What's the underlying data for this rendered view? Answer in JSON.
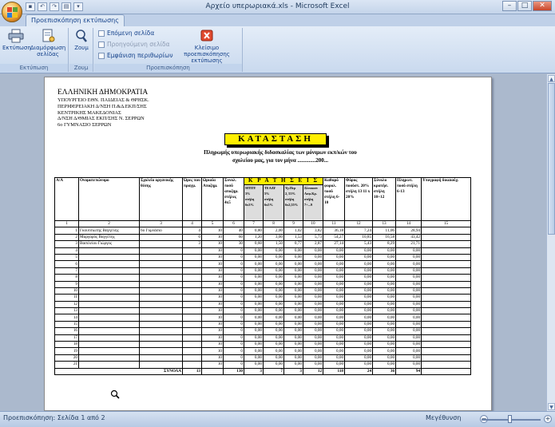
{
  "window": {
    "title": "Αρχείο υπερωριακά.xls - Microsoft Excel",
    "min": "–",
    "max": "□",
    "close": "✕"
  },
  "ribbon": {
    "tab": "Προεπισκόπηση εκτύπωσης",
    "groups": [
      {
        "label": "Εκτύπωση",
        "buttons": [
          "Εκτύπωση",
          "Διαμόρφωση σελίδας"
        ]
      },
      {
        "label": "Ζουμ",
        "buttons": [
          "Ζουμ"
        ]
      },
      {
        "label": "Προεπισκόπηση",
        "buttons": [
          "Επόμενη σελίδα",
          "Προηγούμενη σελίδα",
          "Εμφάνιση περιθωρίων",
          "Κλείσιμο προεπισκόπησης εκτύπωσης"
        ]
      }
    ]
  },
  "header": {
    "lines": [
      "ΕΛΛΗΝΙΚΗ ΔΗΜΟΚΡΑΤΙΑ",
      "ΥΠΟΥΡΓΕΙΟ ΕΘΝ. ΠΑΙΔΕΙΑΣ & ΘΡΗΣΚ.",
      "ΠΕΡΙΦΕΡΕΙΑΚΗ Δ/ΝΣΗ Π.&Δ.ΕΚΠ/ΣΗΣ",
      "ΚΕΝΤΡΙΚΗΣ ΜΑΚΕΔΟΝΙΑΣ",
      "Δ/ΝΣΗ Δ/ΘΜΙΑΣ ΕΚΠ/ΣΗΣ Ν. ΣΕΡΡΩΝ",
      "6ο ΓΥΜΝΑΣΙΟ ΣΕΡΡΩΝ"
    ]
  },
  "katastasi": "ΚΑΤΑΣΤΑΣΗ",
  "subtitle1": "Πληρωμής υπερωριακής διδασκαλίας των μόνιμων εκπ/κών του",
  "subtitle2": "σχολείου μας, για τον μήνα .............200...",
  "table": {
    "h_aa": "Α/Α",
    "h_name": "Ονοματεπώνυμο",
    "h_school": "Σχολείο οργανικής θέσης",
    "h_hours": "Ώρες που πραγμ.",
    "h_rate": "Ωριαία Αποζημ.",
    "h_total": "Συνολ. ποσό αποζημ. στήλες 4x5",
    "kratiseis": "Κ Ρ Α Τ Η Σ Ε Ι Σ",
    "sub": [
      {
        "a": "ΜΤΠΥ",
        "b": "3%",
        "c": "στήλη 6x3%"
      },
      {
        "a": "ΤΕΑΔΥ",
        "b": "5%",
        "c": "στήλη 6x5%"
      },
      {
        "a": "Υγ.Περ",
        "b": "2, 55%",
        "c": "στήλη 6x2,55%"
      },
      {
        "a": "Ξένοιαστ Ασφ.Κρ.",
        "b": "στήλη",
        "c": "7+...9"
      }
    ],
    "h_net": "Καθαρό φορολ. ποσό στήλη 6-10",
    "h_tax": "Φόρος ποσόστ. 20% στήλη 13 11 x 20%",
    "h_sumded": "Σύνολο κρατήσ. στήλη 10+12",
    "h_pay": "Πληρωτ. ποσό στήλη 6-13",
    "h_sign": "Υπογραφή δικαιούχ.",
    "colnums": [
      "1",
      "2",
      "3",
      "4",
      "5",
      "6",
      "7",
      "8",
      "9",
      "10",
      "11",
      "12",
      "13",
      "14",
      "15"
    ],
    "rows": [
      {
        "n": "1",
        "name": "Γκουτσιώτης Βαγγέλης",
        "school": "6ο Γυμνάσιο",
        "h": "4",
        "rate": "10",
        "tot": "40",
        "c7": "0,80",
        "c8": "2,00",
        "c9": "1,02",
        "c10": "3,82",
        "c11": "36,18",
        "c12": "7,24",
        "c13": "11,06",
        "c14": "28,94"
      },
      {
        "n": "2",
        "name": "Μαργαρός Βαγγέλης",
        "school": "",
        "h": "6",
        "rate": "10",
        "tot": "60",
        "c7": "1,20",
        "c8": "3,00",
        "c9": "1,53",
        "c10": "5,73",
        "c11": "54,27",
        "c12": "10,85",
        "c13": "16,58",
        "c14": "43,42"
      },
      {
        "n": "3",
        "name": "Βασιλείου Γιώργος",
        "school": "",
        "h": "3",
        "rate": "10",
        "tot": "30",
        "c7": "0,60",
        "c8": "1,50",
        "c9": "0,77",
        "c10": "2,87",
        "c11": "27,14",
        "c12": "5,43",
        "c13": "8,29",
        "c14": "21,71"
      },
      {
        "n": "4",
        "name": "",
        "school": "",
        "h": "",
        "rate": "10",
        "tot": "0",
        "c7": "0,00",
        "c8": "0,00",
        "c9": "0,00",
        "c10": "0,00",
        "c11": "0,00",
        "c12": "0,00",
        "c13": "0,00",
        "c14": "0,00"
      },
      {
        "n": "5",
        "name": "",
        "school": "",
        "h": "",
        "rate": "10",
        "tot": "0",
        "c7": "0,00",
        "c8": "0,00",
        "c9": "0,00",
        "c10": "0,00",
        "c11": "0,00",
        "c12": "0,00",
        "c13": "0,00",
        "c14": "0,00"
      },
      {
        "n": "6",
        "name": "",
        "school": "",
        "h": "",
        "rate": "10",
        "tot": "0",
        "c7": "0,00",
        "c8": "0,00",
        "c9": "0,00",
        "c10": "0,00",
        "c11": "0,00",
        "c12": "0,00",
        "c13": "0,00",
        "c14": "0,00"
      },
      {
        "n": "7",
        "name": "",
        "school": "",
        "h": "",
        "rate": "10",
        "tot": "0",
        "c7": "0,00",
        "c8": "0,00",
        "c9": "0,00",
        "c10": "0,00",
        "c11": "0,00",
        "c12": "0,00",
        "c13": "0,00",
        "c14": "0,00"
      },
      {
        "n": "8",
        "name": "",
        "school": "",
        "h": "",
        "rate": "10",
        "tot": "0",
        "c7": "0,00",
        "c8": "0,00",
        "c9": "0,00",
        "c10": "0,00",
        "c11": "0,00",
        "c12": "0,00",
        "c13": "0,00",
        "c14": "0,00"
      },
      {
        "n": "9",
        "name": "",
        "school": "",
        "h": "",
        "rate": "10",
        "tot": "0",
        "c7": "0,00",
        "c8": "0,00",
        "c9": "0,00",
        "c10": "0,00",
        "c11": "0,00",
        "c12": "0,00",
        "c13": "0,00",
        "c14": "0,00"
      },
      {
        "n": "10",
        "name": "",
        "school": "",
        "h": "",
        "rate": "10",
        "tot": "0",
        "c7": "0,00",
        "c8": "0,00",
        "c9": "0,00",
        "c10": "0,00",
        "c11": "0,00",
        "c12": "0,00",
        "c13": "0,00",
        "c14": "0,00"
      },
      {
        "n": "11",
        "name": "",
        "school": "",
        "h": "",
        "rate": "10",
        "tot": "0",
        "c7": "0,00",
        "c8": "0,00",
        "c9": "0,00",
        "c10": "0,00",
        "c11": "0,00",
        "c12": "0,00",
        "c13": "0,00",
        "c14": "0,00"
      },
      {
        "n": "12",
        "name": "",
        "school": "",
        "h": "",
        "rate": "10",
        "tot": "0",
        "c7": "0,00",
        "c8": "0,00",
        "c9": "0,00",
        "c10": "0,00",
        "c11": "0,00",
        "c12": "0,00",
        "c13": "0,00",
        "c14": "0,00"
      },
      {
        "n": "13",
        "name": "",
        "school": "",
        "h": "",
        "rate": "10",
        "tot": "0",
        "c7": "0,00",
        "c8": "0,00",
        "c9": "0,00",
        "c10": "0,00",
        "c11": "0,00",
        "c12": "0,00",
        "c13": "0,00",
        "c14": "0,00"
      },
      {
        "n": "14",
        "name": "",
        "school": "",
        "h": "",
        "rate": "10",
        "tot": "0",
        "c7": "0,00",
        "c8": "0,00",
        "c9": "0,00",
        "c10": "0,00",
        "c11": "0,00",
        "c12": "0,00",
        "c13": "0,00",
        "c14": "0,00"
      },
      {
        "n": "15",
        "name": "",
        "school": "",
        "h": "",
        "rate": "10",
        "tot": "0",
        "c7": "0,00",
        "c8": "0,00",
        "c9": "0,00",
        "c10": "0,00",
        "c11": "0,00",
        "c12": "0,00",
        "c13": "0,00",
        "c14": "0,00"
      },
      {
        "n": "16",
        "name": "",
        "school": "",
        "h": "",
        "rate": "10",
        "tot": "0",
        "c7": "0,00",
        "c8": "0,00",
        "c9": "0,00",
        "c10": "0,00",
        "c11": "0,00",
        "c12": "0,00",
        "c13": "0,00",
        "c14": "0,00"
      },
      {
        "n": "17",
        "name": "",
        "school": "",
        "h": "",
        "rate": "10",
        "tot": "0",
        "c7": "0,00",
        "c8": "0,00",
        "c9": "0,00",
        "c10": "0,00",
        "c11": "0,00",
        "c12": "0,00",
        "c13": "0,00",
        "c14": "0,00"
      },
      {
        "n": "18",
        "name": "",
        "school": "",
        "h": "",
        "rate": "10",
        "tot": "0",
        "c7": "0,00",
        "c8": "0,00",
        "c9": "0,00",
        "c10": "0,00",
        "c11": "0,00",
        "c12": "0,00",
        "c13": "0,00",
        "c14": "0,00"
      },
      {
        "n": "19",
        "name": "",
        "school": "",
        "h": "",
        "rate": "10",
        "tot": "0",
        "c7": "0,00",
        "c8": "0,00",
        "c9": "0,00",
        "c10": "0,00",
        "c11": "0,00",
        "c12": "0,00",
        "c13": "0,00",
        "c14": "0,00"
      },
      {
        "n": "20",
        "name": "",
        "school": "",
        "h": "",
        "rate": "10",
        "tot": "0",
        "c7": "0,00",
        "c8": "0,00",
        "c9": "0,00",
        "c10": "0,00",
        "c11": "0,00",
        "c12": "0,00",
        "c13": "0,00",
        "c14": "0,00"
      },
      {
        "n": "21",
        "name": "",
        "school": "",
        "h": "",
        "rate": "10",
        "tot": "0",
        "c7": "0,00",
        "c8": "0,00",
        "c9": "0,00",
        "c10": "0,00",
        "c11": "0,00",
        "c12": "0,00",
        "c13": "0,00",
        "c14": "0,00"
      }
    ],
    "total": {
      "label": "ΣΥΝΟΛΑ",
      "h": "13",
      "rate": "",
      "tot": "130",
      "c7": "3",
      "c8": "7",
      "c9": "3",
      "c10": "12",
      "c11": "118",
      "c12": "24",
      "c13": "36",
      "c14": "94"
    }
  },
  "status": {
    "text": "Προεπισκόπηση: Σελίδα 1 από 2",
    "zoom_label": "Μεγέθυνση"
  },
  "colors": {
    "accent": "#ffef00",
    "ribbon": "#dbe6f4",
    "close": "#c8452a"
  }
}
